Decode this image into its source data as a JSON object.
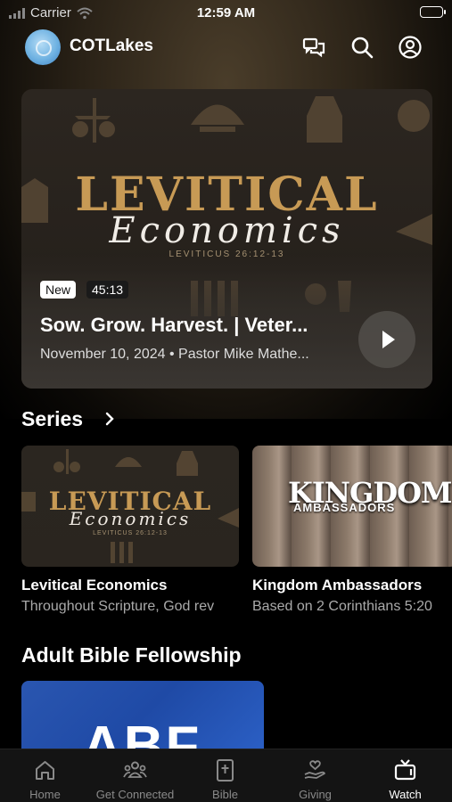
{
  "status_bar": {
    "carrier": "Carrier",
    "time": "12:59 AM"
  },
  "header": {
    "brand": "COTLakes",
    "icons": [
      "chat-icon",
      "search-icon",
      "profile-icon"
    ]
  },
  "featured": {
    "art_title": "LEVITICAL",
    "art_script": "Economics",
    "art_reference": "LEVITICUS 26:12-13",
    "badge_new": "New",
    "duration": "45:13",
    "title": "Sow. Grow. Harvest. | Veter...",
    "subtitle": "November 10, 2024 • Pastor Mike Mathe..."
  },
  "series_section": {
    "title": "Series",
    "items": [
      {
        "art_title": "LEVITICAL",
        "art_script": "Economics",
        "art_reference": "LEVITICUS 26:12-13",
        "name": "Levitical Economics",
        "description": "Throughout Scripture, God rev"
      },
      {
        "art_title": "KINGDOM",
        "art_subtitle": "AMBASSADORS",
        "name": "Kingdom Ambassadors",
        "description": "Based on 2 Corinthians 5:20"
      }
    ]
  },
  "abf_section": {
    "title": "Adult Bible Fellowship",
    "art_text": "ABF"
  },
  "tabbar": {
    "items": [
      {
        "label": "Home",
        "icon": "home-icon",
        "active": false
      },
      {
        "label": "Get Connected",
        "icon": "people-icon",
        "active": false
      },
      {
        "label": "Bible",
        "icon": "bible-icon",
        "active": false
      },
      {
        "label": "Giving",
        "icon": "giving-icon",
        "active": false
      },
      {
        "label": "Watch",
        "icon": "tv-icon",
        "active": true
      }
    ]
  },
  "colors": {
    "gold": "#c79a55",
    "tab_inactive": "#8a8a8a",
    "tab_active": "#ffffff",
    "abf_blue": "#2a56b0"
  }
}
